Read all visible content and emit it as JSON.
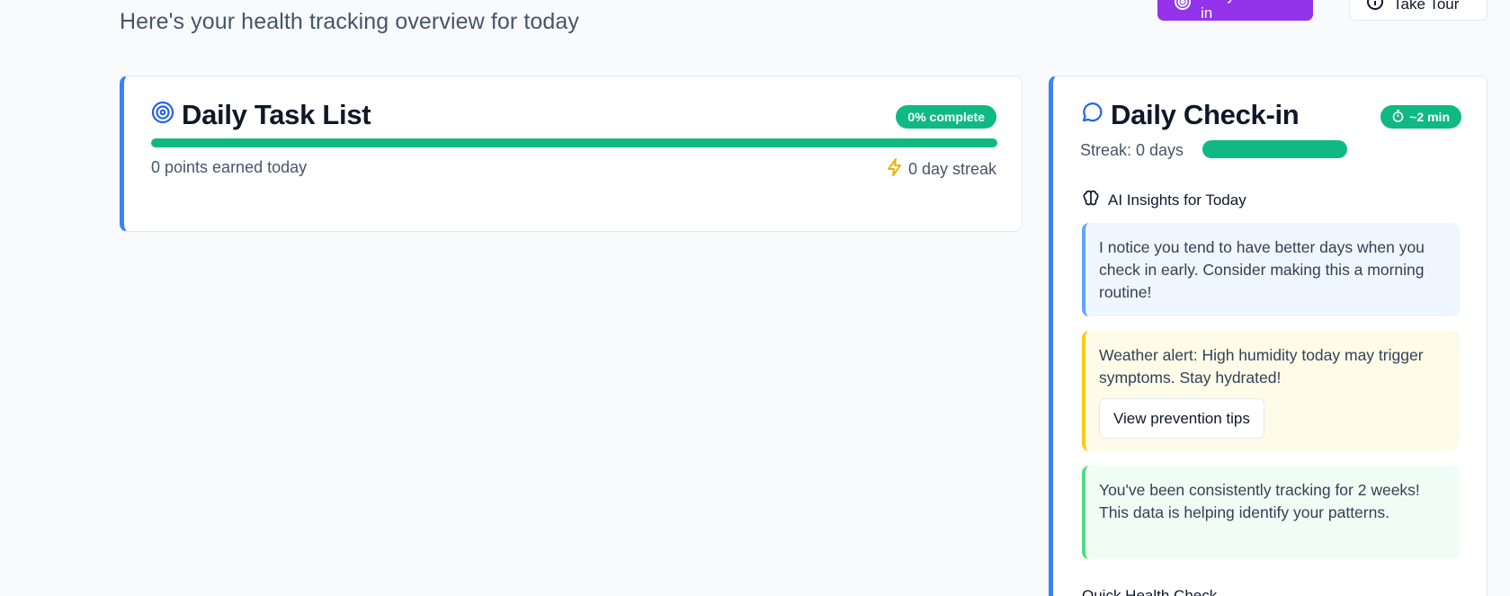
{
  "header": {
    "subtitle": "Here's your health tracking overview for today",
    "daily_checkin_button": "Daily Check-in",
    "take_tour_button": "Take Tour"
  },
  "task_list": {
    "title": "Daily Task List",
    "completion_badge": "0% complete",
    "progress_percent": 100,
    "points_text": "0 points earned today",
    "streak_text": "0 day streak"
  },
  "checkin": {
    "title": "Daily Check-in",
    "time_badge": "~2 min",
    "streak_text": "Streak: 0 days",
    "insights_title": "AI Insights for Today",
    "insights": [
      {
        "text": "I notice you tend to have better days when you check in early. Consider making this a morning routine!"
      },
      {
        "text": "Weather alert: High humidity today may trigger symptoms. Stay hydrated!",
        "action": "View prevention tips"
      },
      {
        "text": "You've been consistently tracking for 2 weeks! This data is helping identify your patterns."
      }
    ],
    "quick_health_check_title": "Quick Health Check"
  },
  "colors": {
    "accent_purple": "#9333ea",
    "accent_blue": "#3b82f6",
    "success_green": "#10b981",
    "streak_yellow": "#eab308"
  },
  "icons": {
    "checkin_button": "target-icon",
    "tour_button": "info-circle-icon",
    "task_title": "target-icon",
    "streak": "lightning-icon",
    "checkin_title": "chat-bubble-icon",
    "time_badge": "timer-icon",
    "insights": "brain-icon"
  }
}
